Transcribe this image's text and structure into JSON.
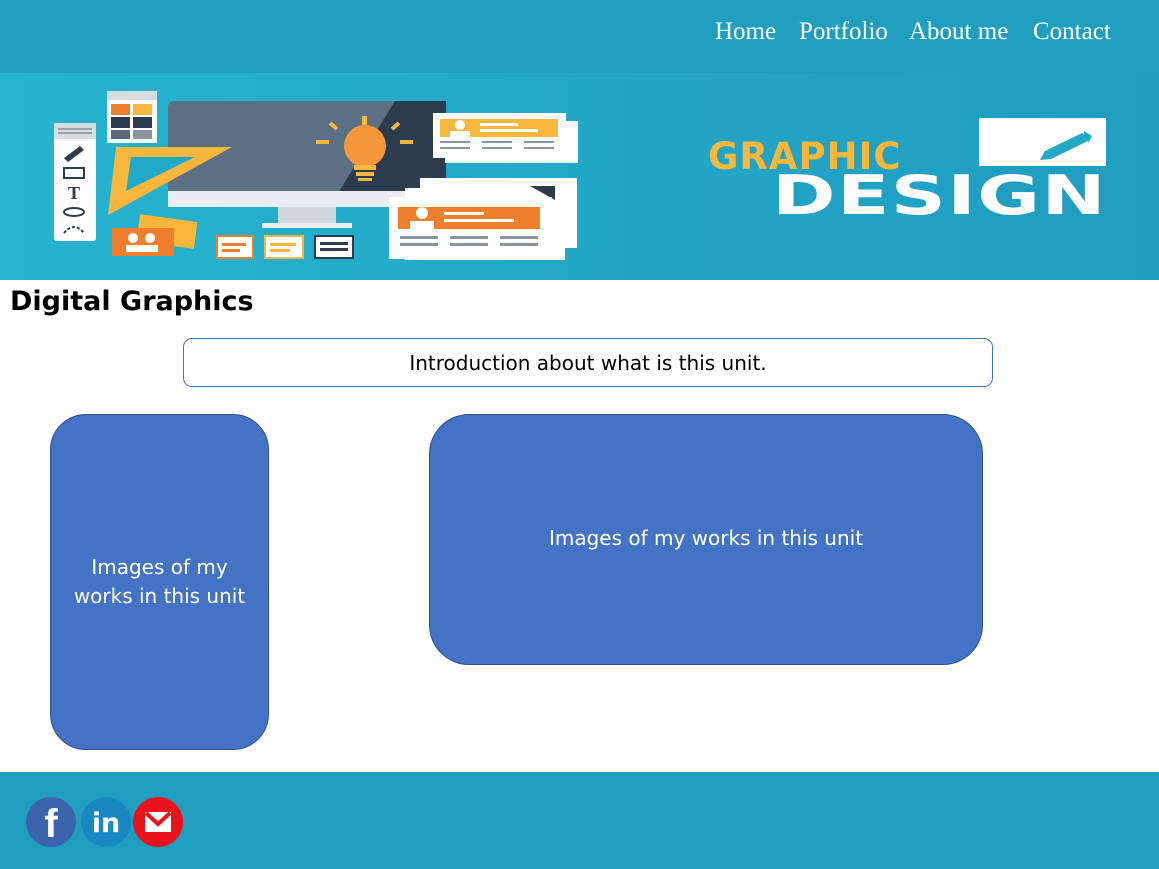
{
  "nav": {
    "items": [
      {
        "label": "Home"
      },
      {
        "label": "Portfolio"
      },
      {
        "label": "About me"
      },
      {
        "label": "Contact"
      }
    ]
  },
  "banner": {
    "logo_line1": "GRAPHIC",
    "logo_line2": "DESIGN",
    "icon": "pencil-icon"
  },
  "main": {
    "title": "Digital Graphics",
    "intro": "Introduction about what is this unit.",
    "cards": [
      {
        "label": "Images of my works in this unit"
      },
      {
        "label": "Images of my works in this unit"
      }
    ]
  },
  "footer": {
    "social": [
      {
        "icon": "facebook-icon",
        "glyph": "f"
      },
      {
        "icon": "linkedin-icon",
        "glyph": "in"
      },
      {
        "icon": "email-icon"
      }
    ]
  },
  "colors": {
    "header": "#209ec0",
    "card": "#4472c4",
    "logo_yellow": "#f6b73c"
  }
}
